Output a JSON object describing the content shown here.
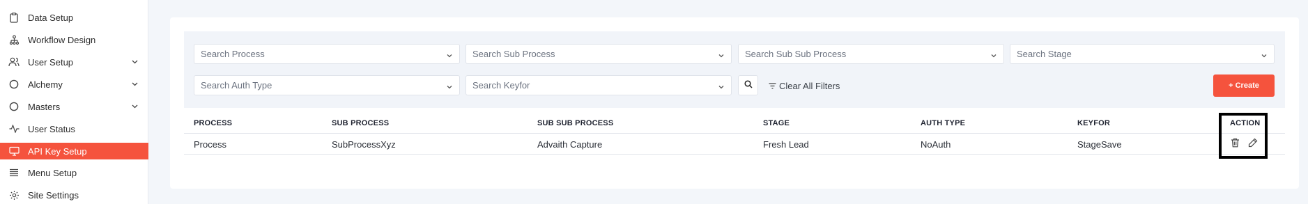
{
  "sidebar": {
    "items": [
      {
        "label": "Data Setup",
        "icon": "clipboard-icon",
        "expandable": false,
        "active": false
      },
      {
        "label": "Workflow Design",
        "icon": "workflow-icon",
        "expandable": false,
        "active": false
      },
      {
        "label": "User Setup",
        "icon": "users-icon",
        "expandable": true,
        "active": false
      },
      {
        "label": "Alchemy",
        "icon": "circle-icon",
        "expandable": true,
        "active": false
      },
      {
        "label": "Masters",
        "icon": "circle-icon",
        "expandable": true,
        "active": false
      },
      {
        "label": "User Status",
        "icon": "activity-icon",
        "expandable": false,
        "active": false
      },
      {
        "label": "API Key Setup",
        "icon": "monitor-icon",
        "expandable": false,
        "active": true
      },
      {
        "label": "Menu Setup",
        "icon": "list-icon",
        "expandable": false,
        "active": false
      },
      {
        "label": "Site Settings",
        "icon": "gear-icon",
        "expandable": false,
        "active": false
      }
    ]
  },
  "filters": {
    "process_placeholder": "Search Process",
    "sub_process_placeholder": "Search Sub Process",
    "sub_sub_process_placeholder": "Search Sub Sub Process",
    "stage_placeholder": "Search Stage",
    "auth_type_placeholder": "Search Auth Type",
    "keyfor_placeholder": "Search Keyfor",
    "clear_label": "Clear All Filters",
    "create_label": "+ Create"
  },
  "table": {
    "columns": [
      "PROCESS",
      "SUB PROCESS",
      "SUB SUB PROCESS",
      "STAGE",
      "AUTH TYPE",
      "KEYFOR",
      "ACTION"
    ],
    "rows": [
      [
        "Process",
        "SubProcessXyz",
        "Advaith Capture",
        "Fresh Lead",
        "NoAuth",
        "StageSave"
      ]
    ]
  },
  "colors": {
    "accent": "#f5533d",
    "background": "#f3f6fa",
    "filter_panel": "#f1f4f9"
  }
}
